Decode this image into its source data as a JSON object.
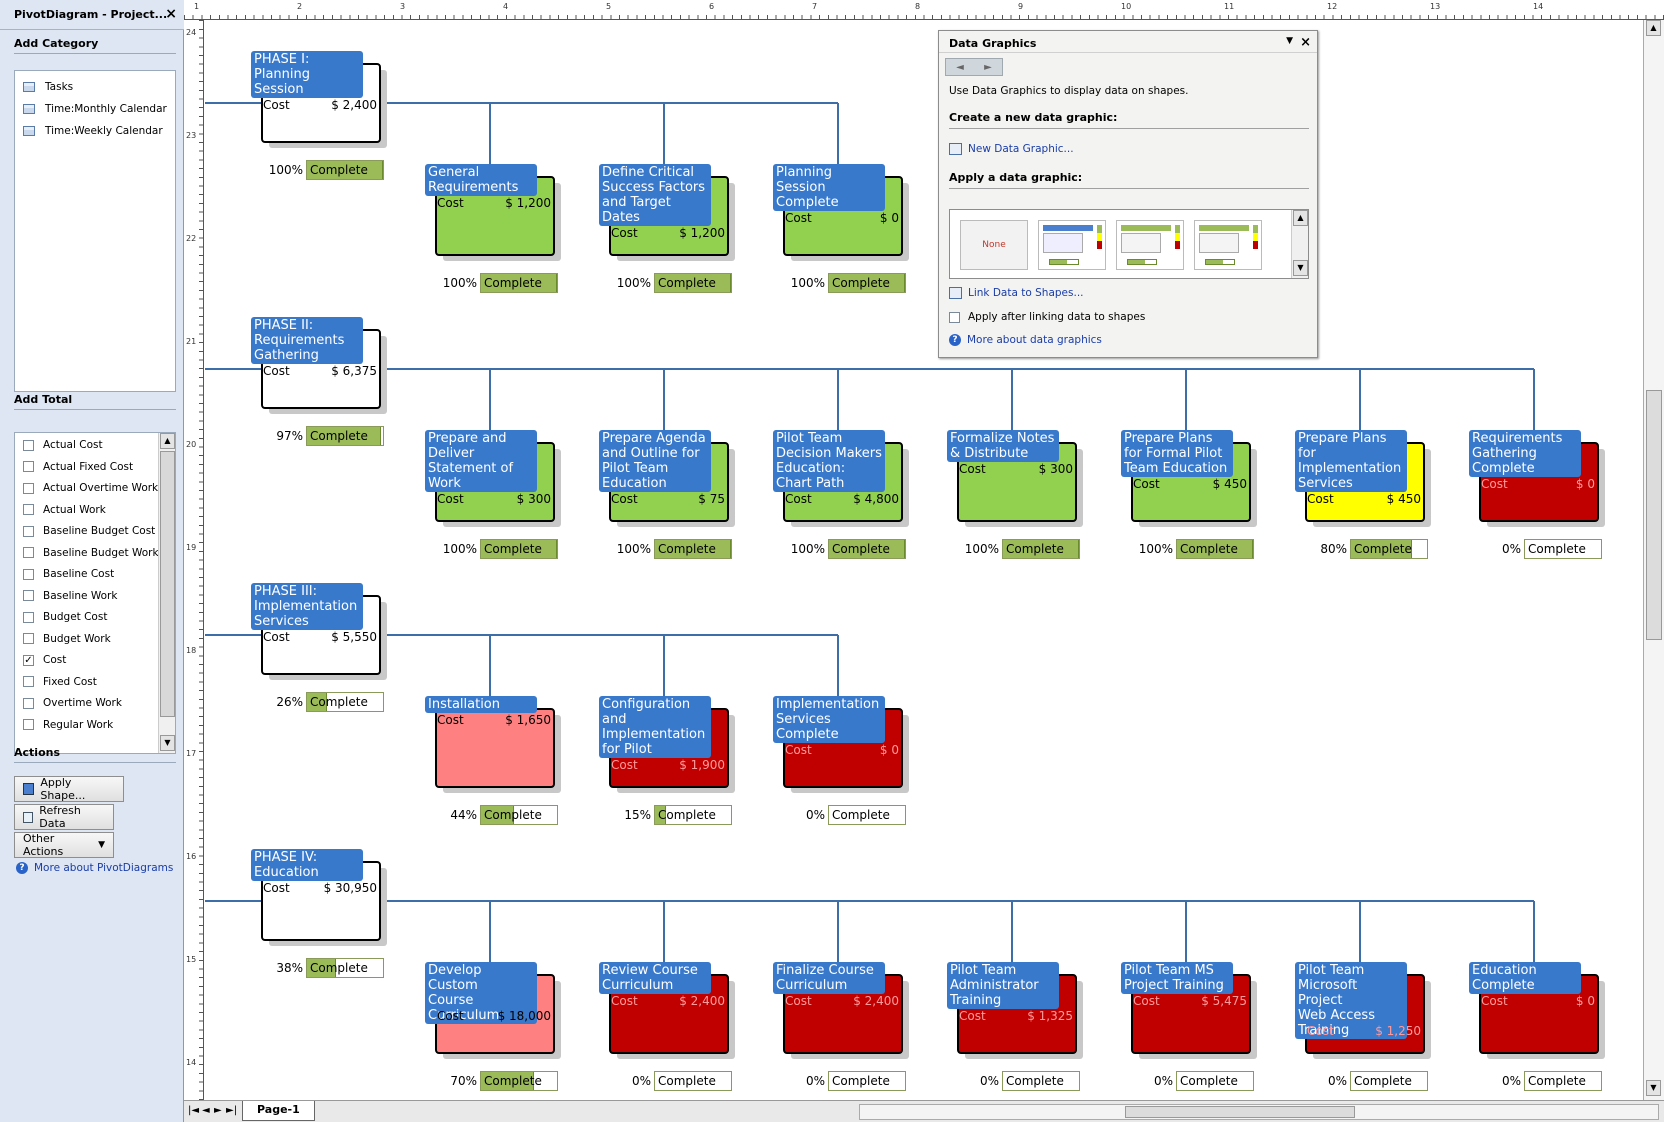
{
  "pane": {
    "title": "PivotDiagram - Project...",
    "close": "×",
    "add_category": {
      "heading": "Add Category",
      "items": [
        "Tasks",
        "Time:Monthly Calendar",
        "Time:Weekly Calendar"
      ]
    },
    "add_total": {
      "heading": "Add Total",
      "items": [
        {
          "label": "Actual Cost",
          "checked": false
        },
        {
          "label": "Actual Fixed Cost",
          "checked": false
        },
        {
          "label": "Actual Overtime Work",
          "checked": false
        },
        {
          "label": "Actual Work",
          "checked": false
        },
        {
          "label": "Baseline Budget Cost",
          "checked": false
        },
        {
          "label": "Baseline Budget Work",
          "checked": false
        },
        {
          "label": "Baseline Cost",
          "checked": false
        },
        {
          "label": "Baseline Work",
          "checked": false
        },
        {
          "label": "Budget Cost",
          "checked": false
        },
        {
          "label": "Budget Work",
          "checked": false
        },
        {
          "label": "Cost",
          "checked": true
        },
        {
          "label": "Fixed Cost",
          "checked": false
        },
        {
          "label": "Overtime Work",
          "checked": false
        },
        {
          "label": "Regular Work",
          "checked": false
        }
      ]
    },
    "actions": {
      "heading": "Actions",
      "apply_shape": "Apply Shape...",
      "refresh_data": "Refresh Data",
      "other_actions": "Other Actions",
      "more_about": "More about PivotDiagrams"
    }
  },
  "ruler_h": [
    "1",
    "2",
    "3",
    "4",
    "5",
    "6",
    "7",
    "8",
    "9",
    "10",
    "11",
    "12",
    "13",
    "14"
  ],
  "ruler_v": [
    "24",
    "23",
    "22",
    "21",
    "20",
    "19",
    "18",
    "17",
    "16",
    "15",
    "14"
  ],
  "data_graphics": {
    "title": "Data Graphics",
    "close": "×",
    "menu": "▼",
    "intro": "Use Data Graphics to display data on shapes.",
    "create_heading": "Create a new data graphic:",
    "new_link": "New Data Graphic...",
    "apply_heading": "Apply a data graphic:",
    "none_label": "None",
    "link_data": "Link Data to Shapes...",
    "apply_after": "Apply after linking data to shapes",
    "more_about": "More about data graphics"
  },
  "cost_label": "Cost",
  "complete_label": "Complete",
  "colors": {
    "green": "#92d050",
    "pink": "#ff8080",
    "red": "#c00000",
    "yellow": "#ffff00",
    "white": "#ffffff",
    "label_blue": "#3979cc"
  },
  "nodes": [
    {
      "lines": [
        "PHASE I:",
        "Planning",
        "Session"
      ],
      "cost": "$ 2,400",
      "pct": "100%",
      "progress": 1.0,
      "status": "white",
      "row": 0,
      "col": -1
    },
    {
      "lines": [
        "General",
        "Requirements"
      ],
      "cost": "$ 1,200",
      "pct": "100%",
      "progress": 1.0,
      "status": "green",
      "row": 0,
      "col": 0
    },
    {
      "lines": [
        "Define Critical",
        "Success Factors",
        "and Target",
        "Dates"
      ],
      "cost": "$ 1,200",
      "pct": "100%",
      "progress": 1.0,
      "status": "green",
      "row": 0,
      "col": 1
    },
    {
      "lines": [
        "Planning",
        "Session",
        "Complete"
      ],
      "cost": "$ 0",
      "pct": "100%",
      "progress": 1.0,
      "status": "green",
      "row": 0,
      "col": 2
    },
    {
      "lines": [
        "PHASE II:",
        "Requirements",
        "Gathering"
      ],
      "cost": "$ 6,375",
      "pct": "97%",
      "progress": 0.97,
      "status": "white",
      "row": 1,
      "col": -1
    },
    {
      "lines": [
        "Prepare and",
        "Deliver",
        "Statement of",
        "Work"
      ],
      "cost": "$ 300",
      "pct": "100%",
      "progress": 1.0,
      "status": "green",
      "row": 1,
      "col": 0
    },
    {
      "lines": [
        "Prepare Agenda",
        "and Outline for",
        "Pilot Team",
        "Education"
      ],
      "cost": "$ 75",
      "pct": "100%",
      "progress": 1.0,
      "status": "green",
      "row": 1,
      "col": 1
    },
    {
      "lines": [
        "Pilot Team",
        "Decision Makers",
        "Education:",
        "Chart Path"
      ],
      "cost": "$ 4,800",
      "pct": "100%",
      "progress": 1.0,
      "status": "green",
      "row": 1,
      "col": 2
    },
    {
      "lines": [
        "Formalize Notes",
        "& Distribute"
      ],
      "cost": "$ 300",
      "pct": "100%",
      "progress": 1.0,
      "status": "green",
      "row": 1,
      "col": 3
    },
    {
      "lines": [
        "Prepare Plans",
        "for Formal Pilot",
        "Team Education"
      ],
      "cost": "$ 450",
      "pct": "100%",
      "progress": 1.0,
      "status": "green",
      "row": 1,
      "col": 4
    },
    {
      "lines": [
        "Prepare Plans",
        "for",
        "Implementation",
        "Services"
      ],
      "cost": "$ 450",
      "pct": "80%",
      "progress": 0.8,
      "status": "yellow",
      "row": 1,
      "col": 5
    },
    {
      "lines": [
        "Requirements",
        "Gathering",
        "Complete"
      ],
      "cost": "$ 0",
      "pct": "0%",
      "progress": 0,
      "status": "red",
      "row": 1,
      "col": 6
    },
    {
      "lines": [
        "PHASE III:",
        "Implementation",
        "Services"
      ],
      "cost": "$ 5,550",
      "pct": "26%",
      "progress": 0.26,
      "status": "white",
      "row": 2,
      "col": -1
    },
    {
      "lines": [
        "Installation"
      ],
      "cost": "$ 1,650",
      "pct": "44%",
      "progress": 0.44,
      "status": "pink",
      "row": 2,
      "col": 0
    },
    {
      "lines": [
        "Configuration",
        "and",
        "Implementation",
        "for Pilot"
      ],
      "cost": "$ 1,900",
      "pct": "15%",
      "progress": 0.15,
      "status": "red",
      "row": 2,
      "col": 1
    },
    {
      "lines": [
        "Implementation",
        "Services",
        "Complete"
      ],
      "cost": "$ 0",
      "pct": "0%",
      "progress": 0,
      "status": "red",
      "row": 2,
      "col": 2
    },
    {
      "lines": [
        "PHASE IV:",
        "Education"
      ],
      "cost": "$ 30,950",
      "pct": "38%",
      "progress": 0.38,
      "status": "white",
      "row": 3,
      "col": -1
    },
    {
      "lines": [
        "Develop Custom",
        "Course",
        "Curriculum"
      ],
      "cost": "$ 18,000",
      "pct": "70%",
      "progress": 0.7,
      "status": "pink",
      "row": 3,
      "col": 0
    },
    {
      "lines": [
        "Review Course",
        "Curriculum"
      ],
      "cost": "$ 2,400",
      "pct": "0%",
      "progress": 0,
      "status": "red",
      "row": 3,
      "col": 1
    },
    {
      "lines": [
        "Finalize Course",
        "Curriculum"
      ],
      "cost": "$ 2,400",
      "pct": "0%",
      "progress": 0,
      "status": "red",
      "row": 3,
      "col": 2
    },
    {
      "lines": [
        "Pilot Team",
        "Administrator",
        "Training"
      ],
      "cost": "$ 1,325",
      "pct": "0%",
      "progress": 0,
      "status": "red",
      "row": 3,
      "col": 3
    },
    {
      "lines": [
        "Pilot Team MS",
        "Project Training"
      ],
      "cost": "$ 5,475",
      "pct": "0%",
      "progress": 0,
      "status": "red",
      "row": 3,
      "col": 4
    },
    {
      "lines": [
        "Pilot Team",
        "Microsoft Project",
        "Web Access",
        "Training"
      ],
      "cost": "$ 1,250",
      "pct": "0%",
      "progress": 0,
      "status": "red",
      "row": 3,
      "col": 5
    },
    {
      "lines": [
        "Education",
        "Complete"
      ],
      "cost": "$ 0",
      "pct": "0%",
      "progress": 0,
      "status": "red",
      "row": 3,
      "col": 6
    }
  ],
  "bottom": {
    "page_tab": "Page-1",
    "nav": [
      "|◄",
      "◄",
      "►",
      "►|"
    ]
  }
}
